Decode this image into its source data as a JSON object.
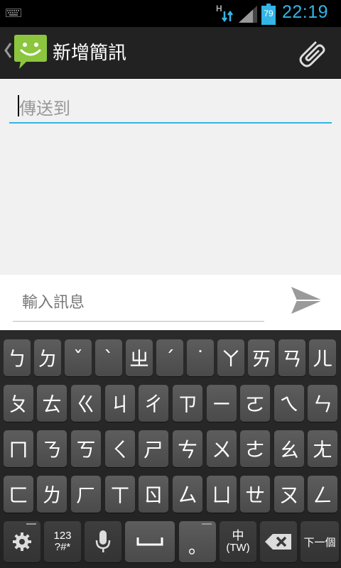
{
  "status_bar": {
    "time": "22:19",
    "battery": "79",
    "network": "H"
  },
  "action_bar": {
    "title": "新增簡訊"
  },
  "compose": {
    "to_placeholder": "傳送到",
    "message_placeholder": "輸入訊息"
  },
  "keyboard": {
    "rows": [
      [
        "ㄅ",
        "ㄉ",
        "ˇ",
        "ˋ",
        "ㄓ",
        "ˊ",
        "˙",
        "ㄚ",
        "ㄞ",
        "ㄢ",
        "ㄦ"
      ],
      [
        "ㄆ",
        "ㄊ",
        "ㄍ",
        "ㄐ",
        "ㄔ",
        "ㄗ",
        "ㄧ",
        "ㄛ",
        "ㄟ",
        "ㄣ"
      ],
      [
        "ㄇ",
        "ㄋ",
        "ㄎ",
        "ㄑ",
        "ㄕ",
        "ㄘ",
        "ㄨ",
        "ㄜ",
        "ㄠ",
        "ㄤ"
      ],
      [
        "ㄈ",
        "ㄌ",
        "ㄏ",
        "ㄒ",
        "ㄖ",
        "ㄙ",
        "ㄩ",
        "ㄝ",
        "ㄡ",
        "ㄥ"
      ]
    ],
    "bottom": {
      "symbols_line1": "123",
      "symbols_line2": "?#*",
      "period": "。",
      "lang_line1": "中",
      "lang_line2": "(TW)",
      "next": "下一個"
    }
  }
}
